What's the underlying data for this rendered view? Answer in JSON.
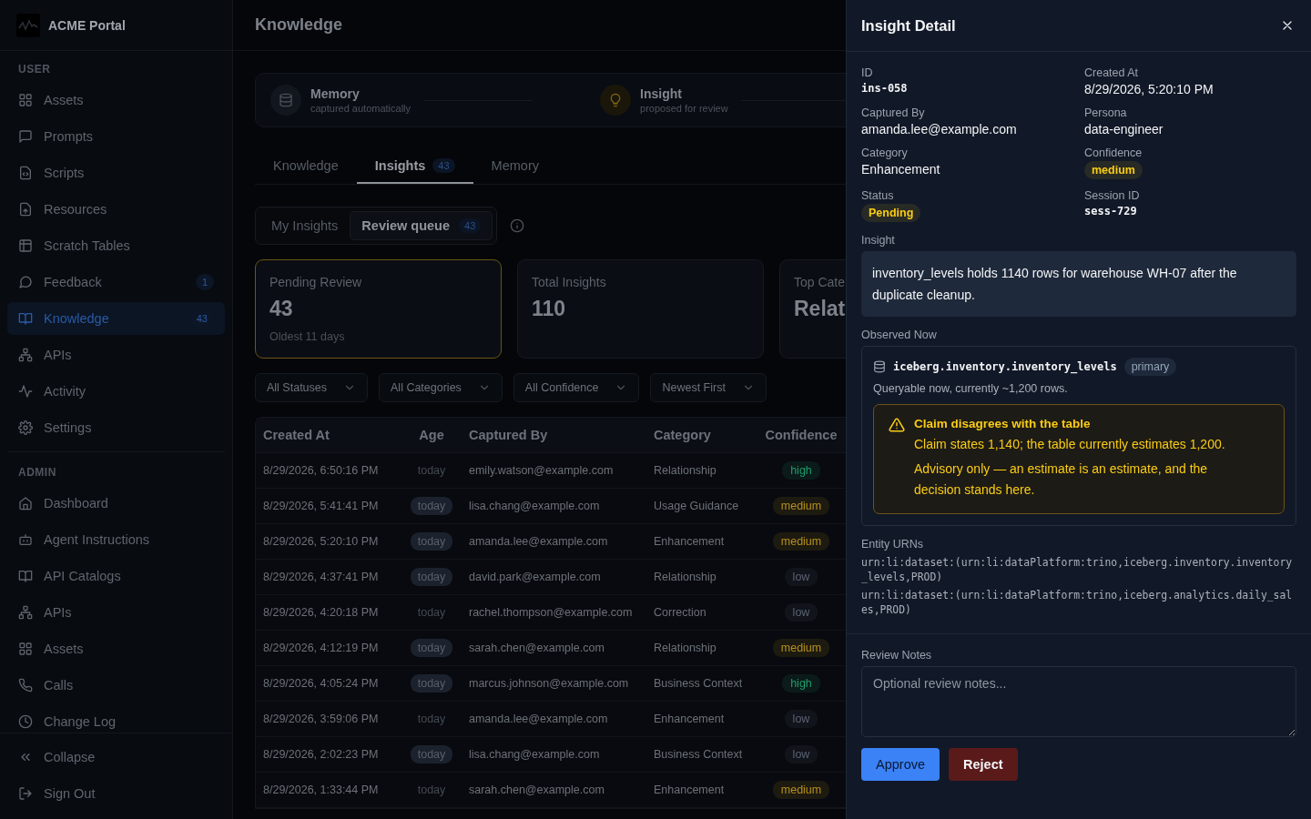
{
  "sidebar": {
    "brand": "ACME Portal",
    "sections": [
      {
        "title": "USER",
        "items": [
          {
            "label": "Assets",
            "selected": false
          },
          {
            "label": "Prompts",
            "selected": false
          },
          {
            "label": "Scripts",
            "selected": false
          },
          {
            "label": "Resources",
            "selected": false
          },
          {
            "label": "Scratch Tables",
            "selected": false
          },
          {
            "label": "Feedback",
            "selected": false,
            "badge": "1"
          },
          {
            "label": "Knowledge",
            "selected": true,
            "badge": "43"
          },
          {
            "label": "APIs",
            "selected": false
          },
          {
            "label": "Activity",
            "selected": false
          },
          {
            "label": "Settings",
            "selected": false
          }
        ]
      },
      {
        "title": "ADMIN",
        "items": [
          {
            "label": "Dashboard",
            "selected": false
          },
          {
            "label": "Agent Instructions",
            "selected": false
          },
          {
            "label": "API Catalogs",
            "selected": false
          },
          {
            "label": "APIs",
            "selected": false
          },
          {
            "label": "Assets",
            "selected": false
          },
          {
            "label": "Calls",
            "selected": false
          },
          {
            "label": "Change Log",
            "selected": false
          }
        ]
      }
    ],
    "footer": [
      "Collapse",
      "Sign Out"
    ]
  },
  "page": {
    "title": "Knowledge",
    "flow": [
      {
        "title": "Memory",
        "subtitle": "captured automatically"
      },
      {
        "title": "Insight",
        "subtitle": "proposed for review"
      }
    ],
    "tabs": [
      {
        "label": "Knowledge",
        "selected": false
      },
      {
        "label": "Insights",
        "selected": true,
        "count": "43"
      },
      {
        "label": "Memory",
        "selected": false
      }
    ],
    "views": [
      {
        "label": "My Insights",
        "selected": false
      },
      {
        "label": "Review queue",
        "selected": true,
        "count": "43"
      }
    ],
    "stats": [
      {
        "label": "Pending Review",
        "value": "43",
        "note": "Oldest 11 days",
        "selected": true
      },
      {
        "label": "Total Insights",
        "value": "110",
        "selected": false
      },
      {
        "label": "Top Cate",
        "value": "Relat",
        "selected": false
      }
    ],
    "filters": [
      "All Statuses",
      "All Categories",
      "All Confidence",
      "Newest First"
    ],
    "table": {
      "columns": [
        "Created At",
        "Age",
        "Captured By",
        "Category",
        "Confidence"
      ],
      "rows": [
        {
          "created": "8/29/2026, 6:50:16 PM",
          "age": "today",
          "age_badge": false,
          "by": "emily.watson@example.com",
          "category": "Relationship",
          "confidence": "high",
          "color": "#1f9d6a"
        },
        {
          "created": "8/29/2026, 5:41:41 PM",
          "age": "today",
          "age_badge": true,
          "by": "lisa.chang@example.com",
          "category": "Usage Guidance",
          "confidence": "medium",
          "color": "#b8901c"
        },
        {
          "created": "8/29/2026, 5:20:10 PM",
          "age": "today",
          "age_badge": true,
          "by": "amanda.lee@example.com",
          "category": "Enhancement",
          "confidence": "medium",
          "color": "#b8901c"
        },
        {
          "created": "8/29/2026, 4:37:41 PM",
          "age": "today",
          "age_badge": true,
          "by": "david.park@example.com",
          "category": "Relationship",
          "confidence": "low",
          "color": "#5a6270"
        },
        {
          "created": "8/29/2026, 4:20:18 PM",
          "age": "today",
          "age_badge": false,
          "by": "rachel.thompson@example.com",
          "category": "Correction",
          "confidence": "low",
          "color": "#5a6270"
        },
        {
          "created": "8/29/2026, 4:12:19 PM",
          "age": "today",
          "age_badge": true,
          "by": "sarah.chen@example.com",
          "category": "Relationship",
          "confidence": "medium",
          "color": "#b8901c"
        },
        {
          "created": "8/29/2026, 4:05:24 PM",
          "age": "today",
          "age_badge": true,
          "by": "marcus.johnson@example.com",
          "category": "Business Context",
          "confidence": "high",
          "color": "#1f9d6a"
        },
        {
          "created": "8/29/2026, 3:59:06 PM",
          "age": "today",
          "age_badge": false,
          "by": "amanda.lee@example.com",
          "category": "Enhancement",
          "confidence": "low",
          "color": "#5a6270"
        },
        {
          "created": "8/29/2026, 2:02:23 PM",
          "age": "today",
          "age_badge": true,
          "by": "lisa.chang@example.com",
          "category": "Business Context",
          "confidence": "low",
          "color": "#5a6270"
        },
        {
          "created": "8/29/2026, 1:33:44 PM",
          "age": "today",
          "age_badge": false,
          "by": "sarah.chen@example.com",
          "category": "Enhancement",
          "confidence": "medium",
          "color": "#b8901c"
        }
      ]
    }
  },
  "drawer": {
    "title": "Insight Detail",
    "fields": [
      {
        "label": "ID",
        "value": "ins-058",
        "kind": "mono"
      },
      {
        "label": "Created At",
        "value": "8/29/2026, 5:20:10 PM",
        "kind": "text"
      },
      {
        "label": "Captured By",
        "value": "amanda.lee@example.com",
        "kind": "text"
      },
      {
        "label": "Persona",
        "value": "data-engineer",
        "kind": "text"
      },
      {
        "label": "Category",
        "value": "Enhancement",
        "kind": "text"
      },
      {
        "label": "Confidence",
        "value": "medium",
        "kind": "badge",
        "color": "#facc15"
      },
      {
        "label": "Status",
        "value": "Pending",
        "kind": "badge",
        "color": "#facc15"
      },
      {
        "label": "Session ID",
        "value": "sess-729",
        "kind": "mono"
      }
    ],
    "insight": {
      "label": "Insight",
      "text": "inventory_levels holds 1140 rows for warehouse WH-07 after the duplicate cleanup."
    },
    "observed": {
      "label": "Observed Now",
      "dataset": "iceberg.inventory.inventory_levels",
      "tag": "primary",
      "note": "Queryable now, currently ~1,200 rows.",
      "warning": {
        "title": "Claim disagrees with the table",
        "lines": [
          "Claim states 1,140; the table currently estimates 1,200.",
          "Advisory only — an estimate is an estimate, and the decision stands here."
        ]
      }
    },
    "urns": {
      "label": "Entity URNs",
      "items": [
        "urn:li:dataset:(urn:li:dataPlatform:trino,iceberg.inventory.inventory_levels,PROD)",
        "urn:li:dataset:(urn:li:dataPlatform:trino,iceberg.analytics.daily_sales,PROD)"
      ]
    },
    "notes": {
      "label": "Review Notes",
      "placeholder": "Optional review notes..."
    },
    "actions": [
      {
        "label": "Approve",
        "kind": "primary"
      },
      {
        "label": "Reject",
        "kind": "danger"
      }
    ]
  }
}
